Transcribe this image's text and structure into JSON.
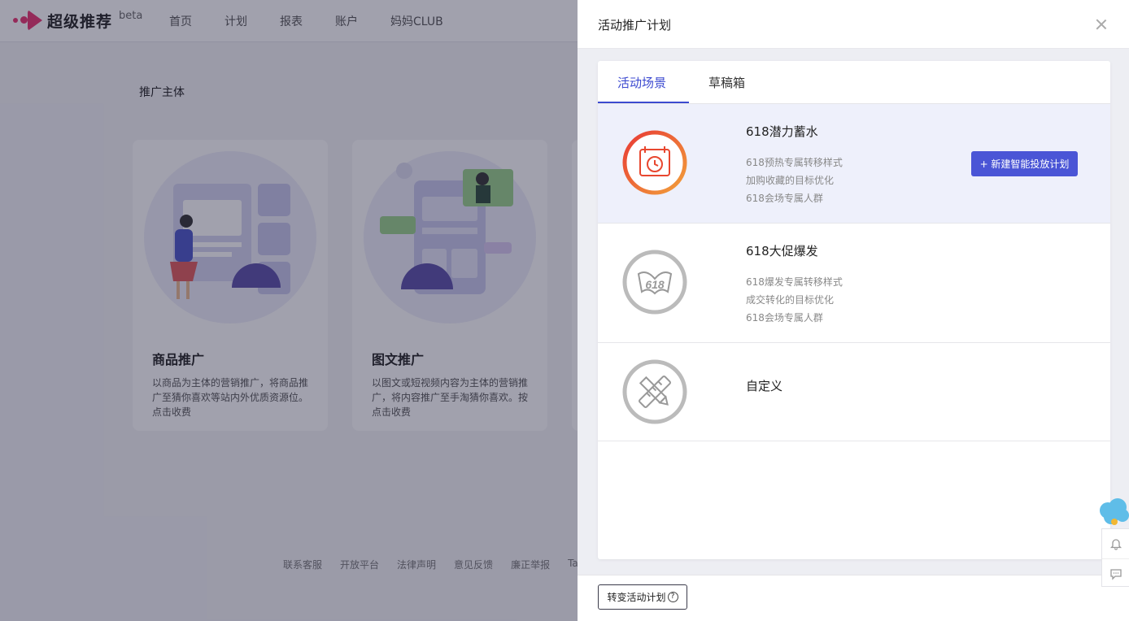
{
  "app": {
    "logo_text": "超级推荐",
    "logo_badge": "beta",
    "nav": [
      "首页",
      "计划",
      "报表",
      "账户",
      "妈妈CLUB"
    ]
  },
  "background": {
    "section_title": "推广主体",
    "cards": [
      {
        "title": "商品推广",
        "desc": "以商品为主体的营销推广，将商品推广至猜你喜欢等站内外优质资源位。点击收费"
      },
      {
        "title": "图文推广",
        "desc": "以图文或短视频内容为主体的营销推广，将内容推广至手淘猜你喜欢。按点击收费"
      }
    ],
    "footer_links": [
      "联系客服",
      "开放平台",
      "法律声明",
      "意见反馈",
      "廉正举报",
      "Ta"
    ]
  },
  "drawer": {
    "title": "活动推广计划",
    "tabs": [
      {
        "label": "活动场景",
        "active": true
      },
      {
        "label": "草稿箱",
        "active": false
      }
    ],
    "scenes": [
      {
        "title": "618潜力蓄水",
        "lines": [
          "618预热专属转移样式",
          "加购收藏的目标优化",
          "618会场专属人群"
        ],
        "selected": true,
        "icon": "alarm-clock-calendar-icon",
        "ring_color": "#e8472f"
      },
      {
        "title": "618大促爆发",
        "lines": [
          "618爆发专属转移样式",
          "成交转化的目标优化",
          "618会场专属人群"
        ],
        "selected": false,
        "icon": "618-bow-icon",
        "ring_color": "#bbbbbb"
      },
      {
        "title": "自定义",
        "lines": [],
        "selected": false,
        "icon": "pencil-ruler-icon",
        "ring_color": "#bbbbbb"
      }
    ],
    "create_button": "+ 新建智能投放计划",
    "footer_button": "转变活动计划",
    "footer_help": "?"
  },
  "colors": {
    "accent": "#4a55d6",
    "tab_active": "#3c4ad0",
    "brand": "#e8336f"
  }
}
